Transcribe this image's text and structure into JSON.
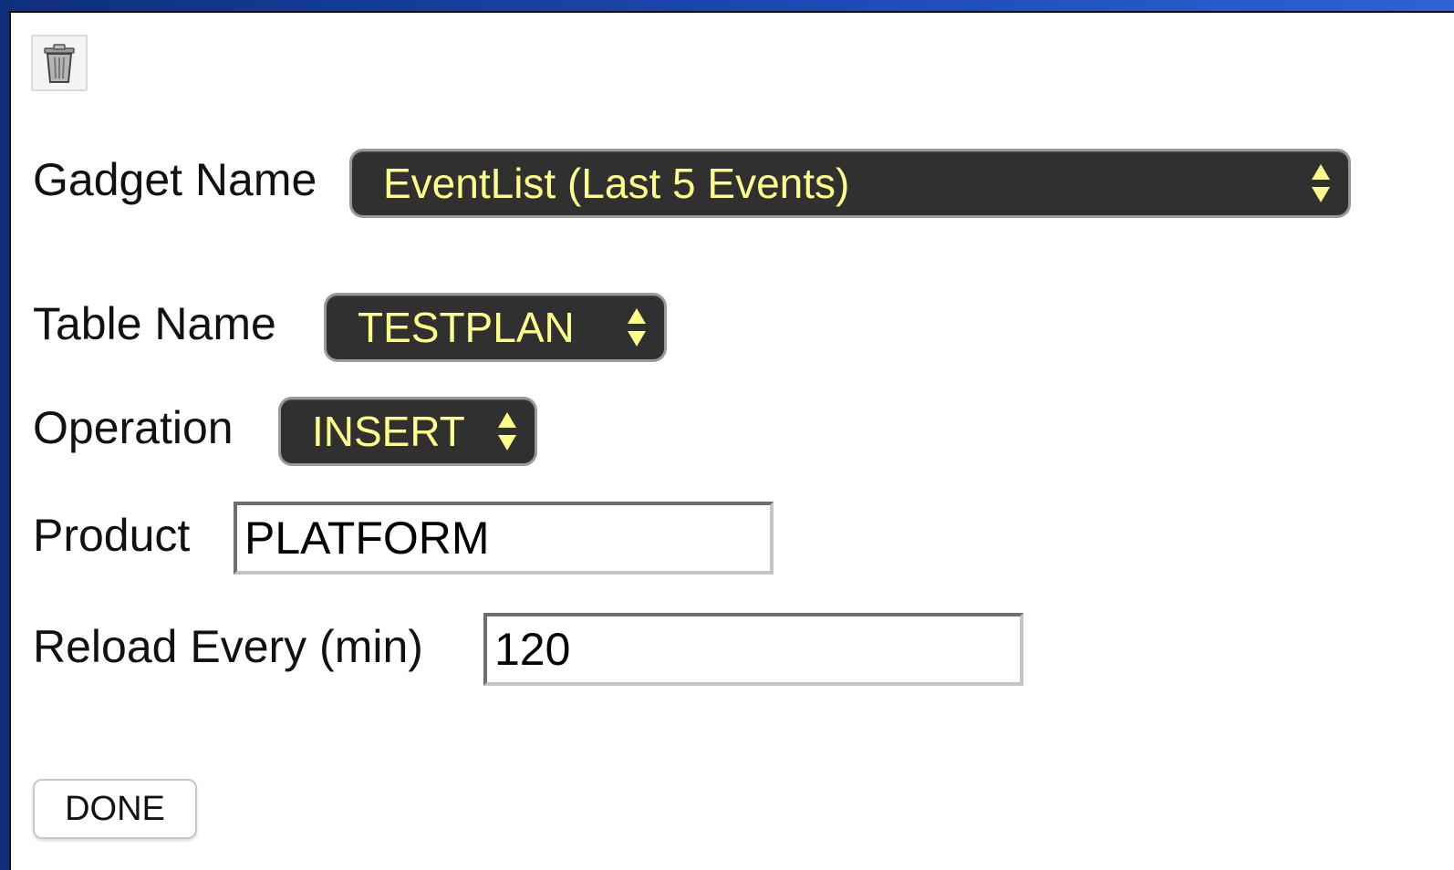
{
  "toolbar": {
    "delete_icon": "trash-icon"
  },
  "form": {
    "gadget_name": {
      "label": "Gadget Name",
      "value": "EventList (Last 5 Events)"
    },
    "table_name": {
      "label": "Table Name",
      "value": "TESTPLAN"
    },
    "operation": {
      "label": "Operation",
      "value": "INSERT"
    },
    "product": {
      "label": "Product",
      "value": "PLATFORM"
    },
    "reload": {
      "label": "Reload Every (min)",
      "value": "120"
    }
  },
  "actions": {
    "done_label": "DONE"
  },
  "colors": {
    "select_bg": "#303030",
    "select_text": "#ffff8a",
    "frame_blue": "#1c49b4"
  }
}
